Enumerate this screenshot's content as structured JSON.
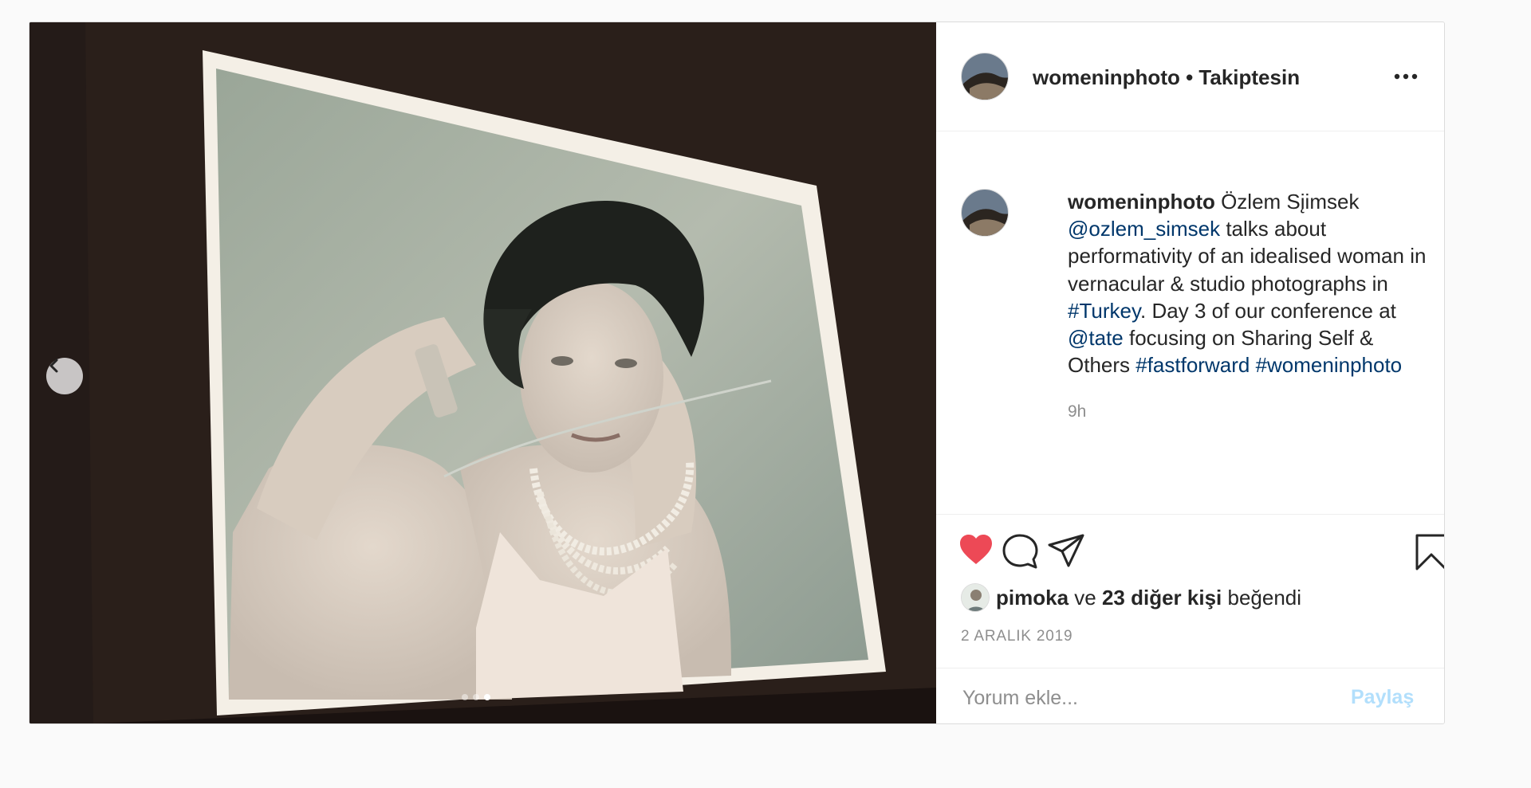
{
  "post": {
    "author": {
      "username": "womeninphoto",
      "follow_status": "Takiptesin",
      "separator": " • "
    },
    "caption": {
      "username": "womeninphoto",
      "text_1": " Özlem Sįimsek ",
      "mention_1": "@ozlem_simsek",
      "text_2": " talks about performativity of an idealised woman in vernacular & studio photographs in ",
      "hashtag_1": "#Turkey",
      "text_3": ". Day 3 of our conference at ",
      "mention_2": "@tate",
      "text_4": " focusing on Sharing Self & Others ",
      "hashtag_2": "#fastforward",
      "text_5": " ",
      "hashtag_3": "#womeninphoto"
    },
    "time_ago": "9h",
    "likes": {
      "liker": "pimoka",
      "conjunction": " ve ",
      "others": "23 diğer kişi",
      "suffix": " beğendi"
    },
    "date": "2 ARALIK 2019",
    "comment": {
      "placeholder": "Yorum ekle...",
      "post_label": "Paylaş"
    },
    "carousel": {
      "count": 3,
      "active_index": 2
    },
    "icons": {
      "more": "more-options-icon",
      "like": "heart-filled-icon",
      "comment": "comment-icon",
      "share": "share-icon",
      "save": "bookmark-icon",
      "prev": "chevron-left-icon"
    },
    "colors": {
      "like": "#ed4956",
      "link": "#00376b",
      "post_button_disabled": "#b2dffc",
      "muted": "#8e8e8e"
    }
  }
}
